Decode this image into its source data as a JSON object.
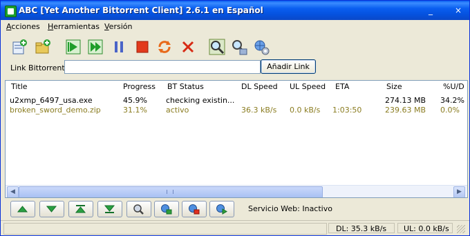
{
  "window": {
    "title": "ABC [Yet Another Bittorrent Client] 2.6.1 en Español",
    "minimize_glyph": "_",
    "close_glyph": "×"
  },
  "menu": [
    "Acciones",
    "Herramientas",
    "Versión"
  ],
  "toolbar": {
    "icons": [
      "add-torrent-file-icon",
      "add-torrent-folder-icon",
      "resume-icon",
      "resume-all-icon",
      "pause-icon",
      "stop-icon",
      "refresh-icon",
      "remove-icon",
      "search-icon",
      "web-search-icon",
      "web-settings-icon"
    ]
  },
  "link_row": {
    "label": "Link Bittorrent",
    "input_value": "",
    "add_button": "Añadir Link"
  },
  "table": {
    "columns": [
      "Title",
      "Progress",
      "BT Status",
      "DL Speed",
      "UL Speed",
      "ETA",
      "Size",
      "%U/D"
    ],
    "rows": [
      {
        "title": "u2xmp_6497_usa.exe",
        "progress": "45.9%",
        "status": "checking existin...",
        "dl": "",
        "ul": "",
        "eta": "",
        "size": "274.13 MB",
        "ud": "34.2%"
      },
      {
        "title": "broken_sword_demo.zip",
        "progress": "31.1%",
        "status": "activo",
        "dl": "36.3 kB/s",
        "ul": "0.0 kB/s",
        "eta": "1:03:50",
        "size": "239.63 MB",
        "ud": "0.0%"
      }
    ]
  },
  "bottom": {
    "buttons": [
      "move-up-icon",
      "move-down-icon",
      "move-top-icon",
      "move-bottom-icon",
      "torrent-info-icon",
      "network-icon",
      "network-stop-icon",
      "network-start-icon"
    ],
    "service_label": "Servicio Web: Inactivo"
  },
  "status": {
    "dl": "DL: 35.3 kB/s",
    "ul": "UL: 0.0 kB/s"
  },
  "colors": {
    "title_bar": "#0a5ef0",
    "row_active_text": "#8a7c20",
    "face": "#ece9d8"
  }
}
